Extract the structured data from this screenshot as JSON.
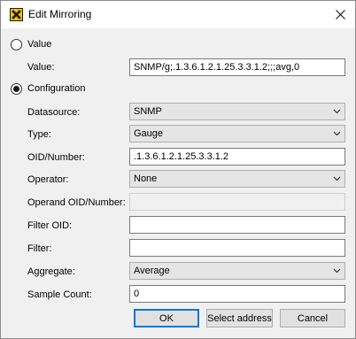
{
  "window": {
    "title": "Edit Mirroring",
    "icon": "app-x-icon",
    "close_icon": "close-icon"
  },
  "mode": {
    "value_label": "Value",
    "configuration_label": "Configuration",
    "selected": "Configuration"
  },
  "value_section": {
    "label": "Value:",
    "value": "SNMP/g;.1.3.6.1.2.1.25.3.3.1.2;;;avg,0"
  },
  "config": {
    "datasource": {
      "label": "Datasource:",
      "value": "SNMP"
    },
    "type": {
      "label": "Type:",
      "value": "Gauge"
    },
    "oid": {
      "label": "OID/Number:",
      "value": ".1.3.6.1.2.1.25.3.3.1.2"
    },
    "operator": {
      "label": "Operator:",
      "value": "None"
    },
    "operand_oid": {
      "label": "Operand OID/Number:",
      "value": ""
    },
    "filter_oid": {
      "label": "Filter OID:",
      "value": ""
    },
    "filter": {
      "label": "Filter:",
      "value": ""
    },
    "aggregate": {
      "label": "Aggregate:",
      "value": "Average"
    },
    "sample_count": {
      "label": "Sample Count:",
      "value": "0"
    }
  },
  "buttons": {
    "ok": "OK",
    "select_address": "Select address",
    "cancel": "Cancel"
  }
}
